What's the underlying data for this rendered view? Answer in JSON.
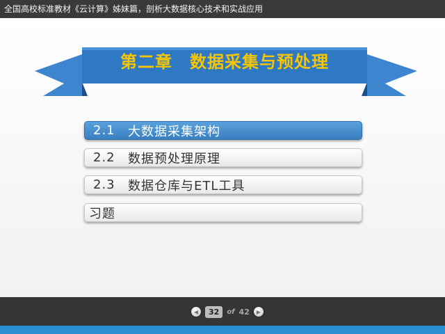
{
  "header": {
    "text": "全国高校标准教材《云计算》姊妹篇，剖析大数据核心技术和实战应用"
  },
  "banner": {
    "title": "第二章　数据采集与预处理"
  },
  "menu": {
    "items": [
      {
        "num": "2.1",
        "label": "大数据采集架构",
        "active": true
      },
      {
        "num": "2.2",
        "label": "数据预处理原理",
        "active": false
      },
      {
        "num": "2.3",
        "label": "数据仓库与ETL工具",
        "active": false
      },
      {
        "label": "习题",
        "active": false
      }
    ]
  },
  "pager": {
    "current": "32",
    "of": "of",
    "total": "42"
  },
  "colors": {
    "ribbon": "#2f78c4",
    "ribbon_dark": "#1d4f86",
    "title": "#f7c600",
    "active_item": "#4a90d0",
    "bottom_strip": "#2a8fd0"
  },
  "icons": {
    "prev": "circle-left-icon",
    "next": "circle-right-icon"
  }
}
